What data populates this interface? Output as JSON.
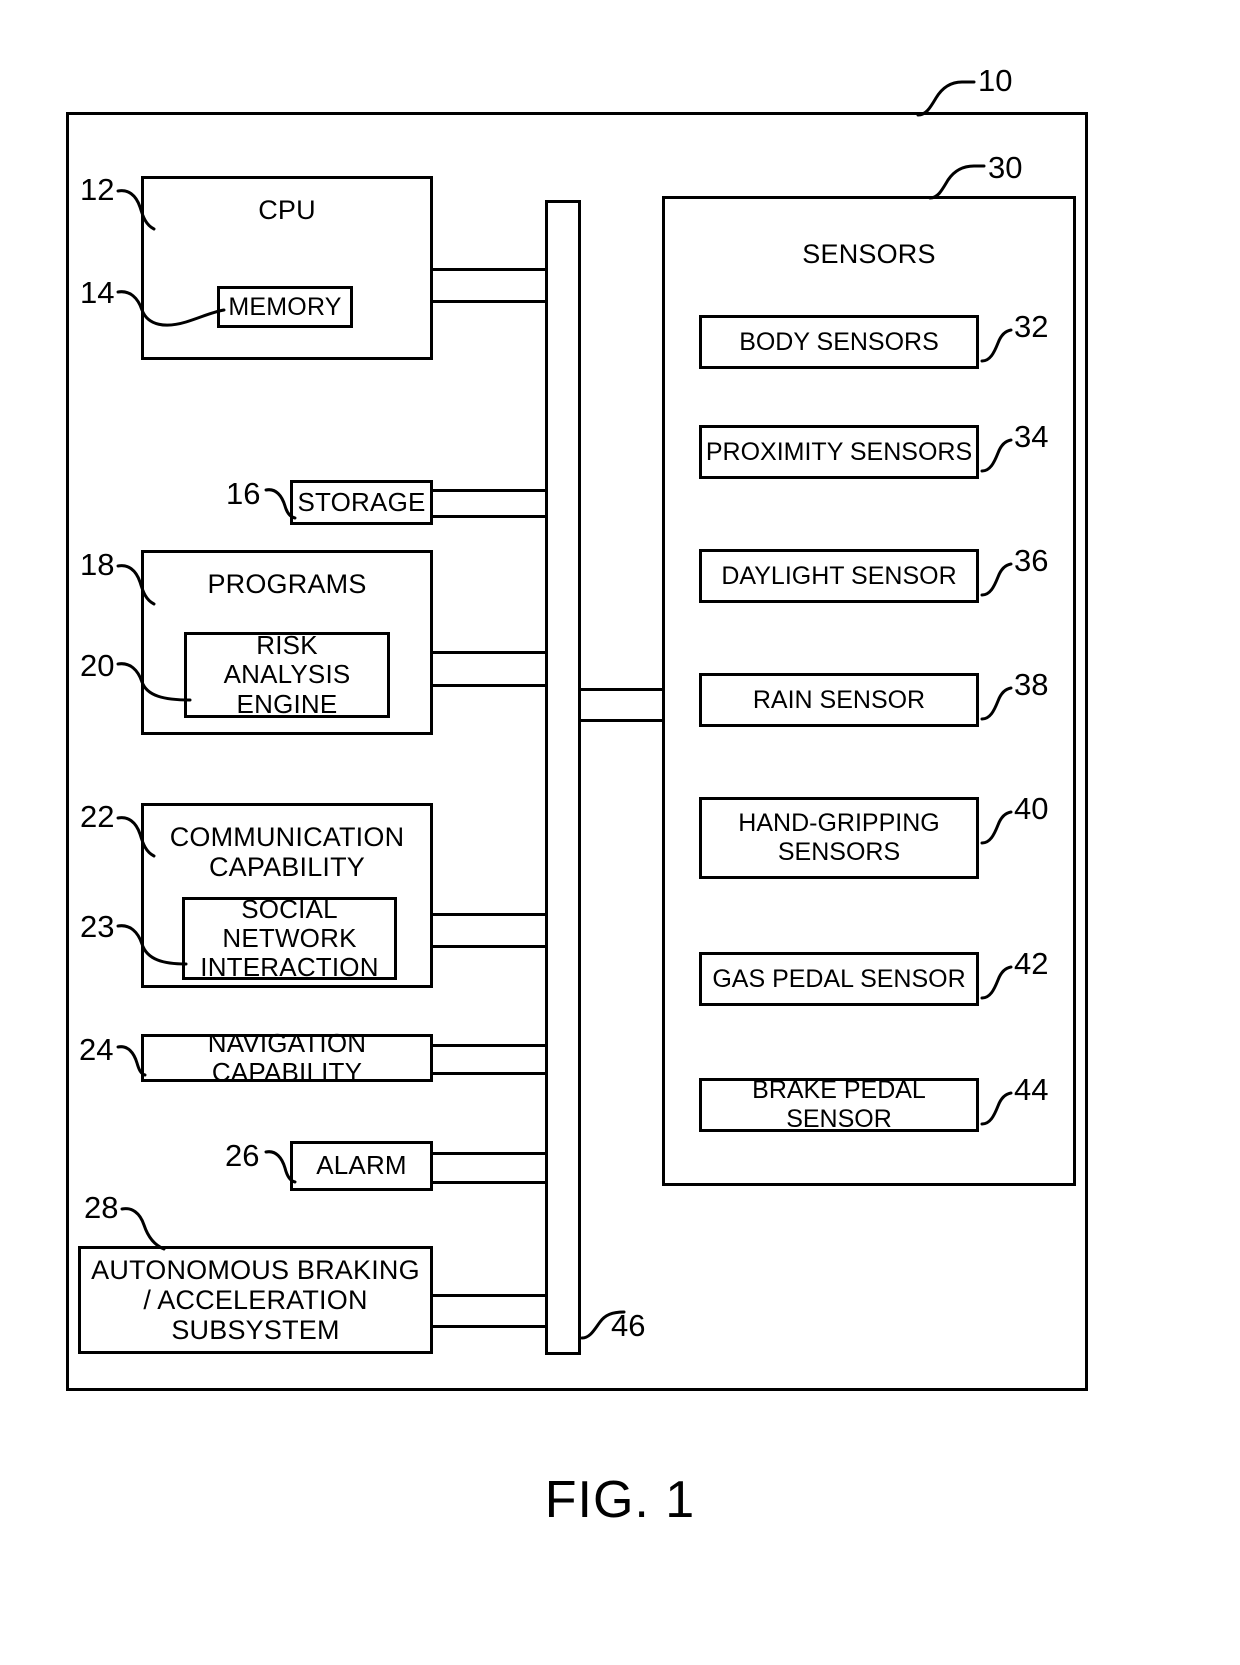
{
  "figure": {
    "caption": "FIG. 1",
    "system_ref": "10",
    "bus_ref": "46"
  },
  "left_column": {
    "cpu": {
      "ref": "12",
      "label": "CPU",
      "memory": {
        "ref": "14",
        "label": "MEMORY"
      }
    },
    "storage": {
      "ref": "16",
      "label": "STORAGE"
    },
    "programs": {
      "ref": "18",
      "label": "PROGRAMS",
      "risk_engine": {
        "ref": "20",
        "label": "RISK ANALYSIS ENGINE"
      }
    },
    "communication": {
      "ref": "22",
      "label": "COMMUNICATION CAPABILITY",
      "social": {
        "ref": "23",
        "label": "SOCIAL NETWORK INTERACTION"
      }
    },
    "navigation": {
      "ref": "24",
      "label": "NAVIGATION CAPABILITY"
    },
    "alarm": {
      "ref": "26",
      "label": "ALARM"
    },
    "autonomous": {
      "ref": "28",
      "label": "AUTONOMOUS BRAKING / ACCELERATION SUBSYSTEM"
    }
  },
  "sensors_panel": {
    "ref": "30",
    "label": "SENSORS",
    "items": [
      {
        "ref": "32",
        "label": "BODY SENSORS"
      },
      {
        "ref": "34",
        "label": "PROXIMITY SENSORS"
      },
      {
        "ref": "36",
        "label": "DAYLIGHT SENSOR"
      },
      {
        "ref": "38",
        "label": "RAIN SENSOR"
      },
      {
        "ref": "40",
        "label": "HAND-GRIPPING SENSORS"
      },
      {
        "ref": "42",
        "label": "GAS PEDAL SENSOR"
      },
      {
        "ref": "44",
        "label": "BRAKE PEDAL SENSOR"
      }
    ]
  },
  "colors": {
    "ink": "#000000",
    "paper": "#ffffff"
  }
}
